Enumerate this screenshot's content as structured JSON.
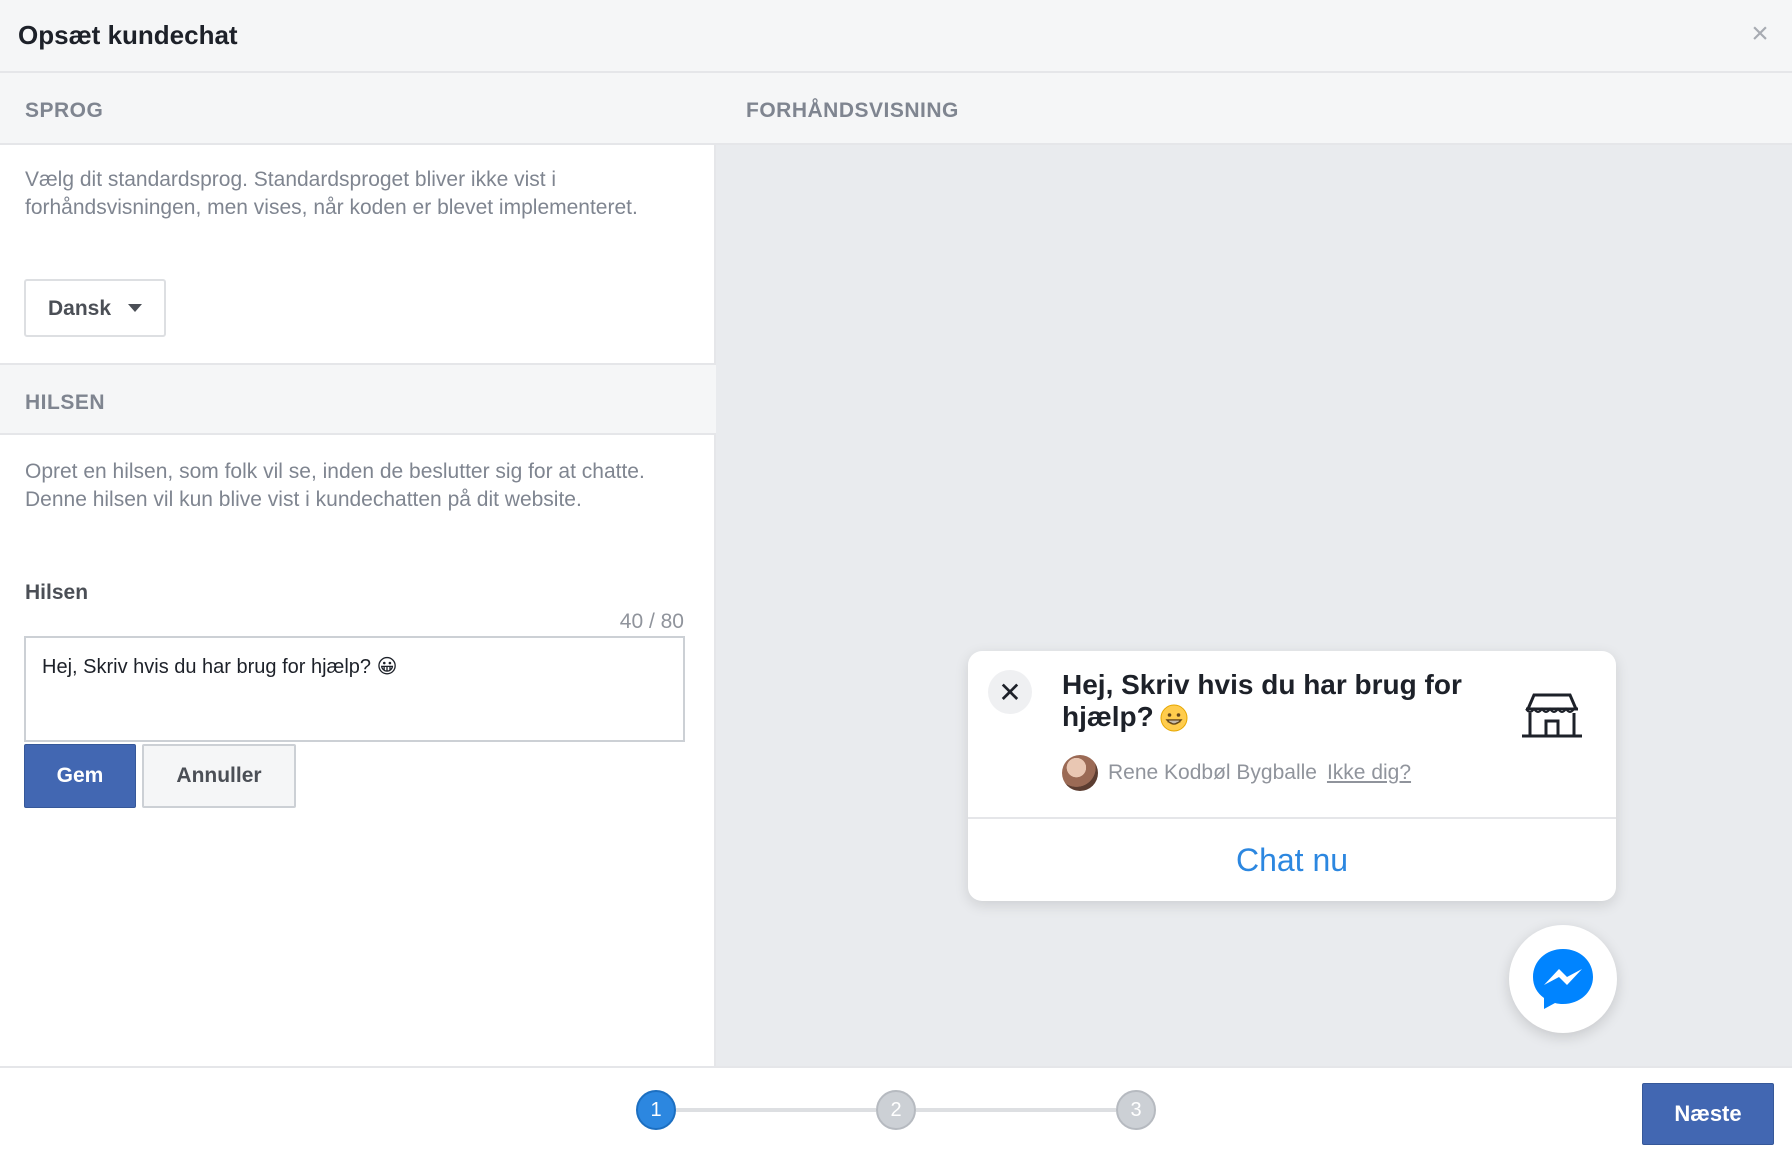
{
  "header": {
    "title": "Opsæt kundechat",
    "close_label": "×"
  },
  "language": {
    "section_title": "SPROG",
    "description": "Vælg dit standardsprog. Standardsproget bliver ikke vist i forhåndsvisningen, men vises, når koden er blevet implementeret.",
    "selected": "Dansk"
  },
  "greeting": {
    "section_title": "HILSEN",
    "description": "Opret en hilsen, som folk vil se, inden de beslutter sig for at chatte. Denne hilsen vil kun blive vist i kundechatten på dit website.",
    "field_label": "Hilsen",
    "counter": "40 / 80",
    "value": "Hej, Skriv hvis du har brug for hjælp? 😀",
    "save_label": "Gem",
    "cancel_label": "Annuller"
  },
  "preview": {
    "section_title": "FORHÅNDSVISNING",
    "close_label": "✕",
    "greeting_text": "Hej, Skriv hvis du har brug for hjælp?",
    "user_name": "Rene Kodbøl Bygballe",
    "not_you": "Ikke dig?",
    "chat_now": "Chat nu"
  },
  "footer": {
    "steps": [
      "1",
      "2",
      "3"
    ],
    "active_step": 1,
    "next_label": "Næste"
  },
  "colors": {
    "primary": "#4267b2",
    "link_blue": "#2c87e0",
    "preview_bg": "#e9ebee",
    "messenger_blue": "#0084ff"
  },
  "icons": {
    "close": "close-icon",
    "caret": "caret-down-icon",
    "store": "store-icon",
    "messenger": "messenger-icon",
    "emoji": "grinning-emoji-icon"
  }
}
